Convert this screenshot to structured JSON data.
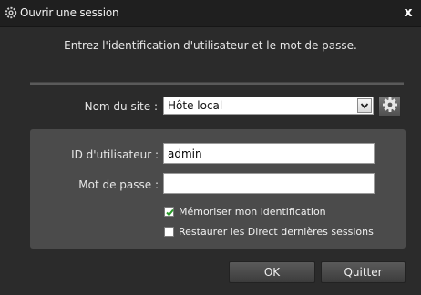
{
  "window": {
    "title": "Ouvrir une session",
    "close_label": "x"
  },
  "instruction": "Entrez l'identification d'utilisateur et le mot de passe.",
  "site": {
    "label": "Nom du site :",
    "selected": "Hôte local"
  },
  "form": {
    "user_id_label": "ID d'utilisateur :",
    "user_id_value": "admin",
    "password_label": "Mot de passe :",
    "password_value": ""
  },
  "options": {
    "remember_label": "Mémoriser mon identification",
    "remember_checked": true,
    "restore_label": "Restaurer les Direct dernières sessions",
    "restore_checked": false
  },
  "buttons": {
    "ok": "OK",
    "quit": "Quitter"
  },
  "icons": {
    "title": "gear-icon",
    "site_settings": "gear-icon",
    "dropdown": "chevron-down-icon",
    "check": "checkmark-icon"
  },
  "colors": {
    "background": "#2b2b2b",
    "panel": "#4b4b4b",
    "check_green": "#2a9a2a"
  }
}
